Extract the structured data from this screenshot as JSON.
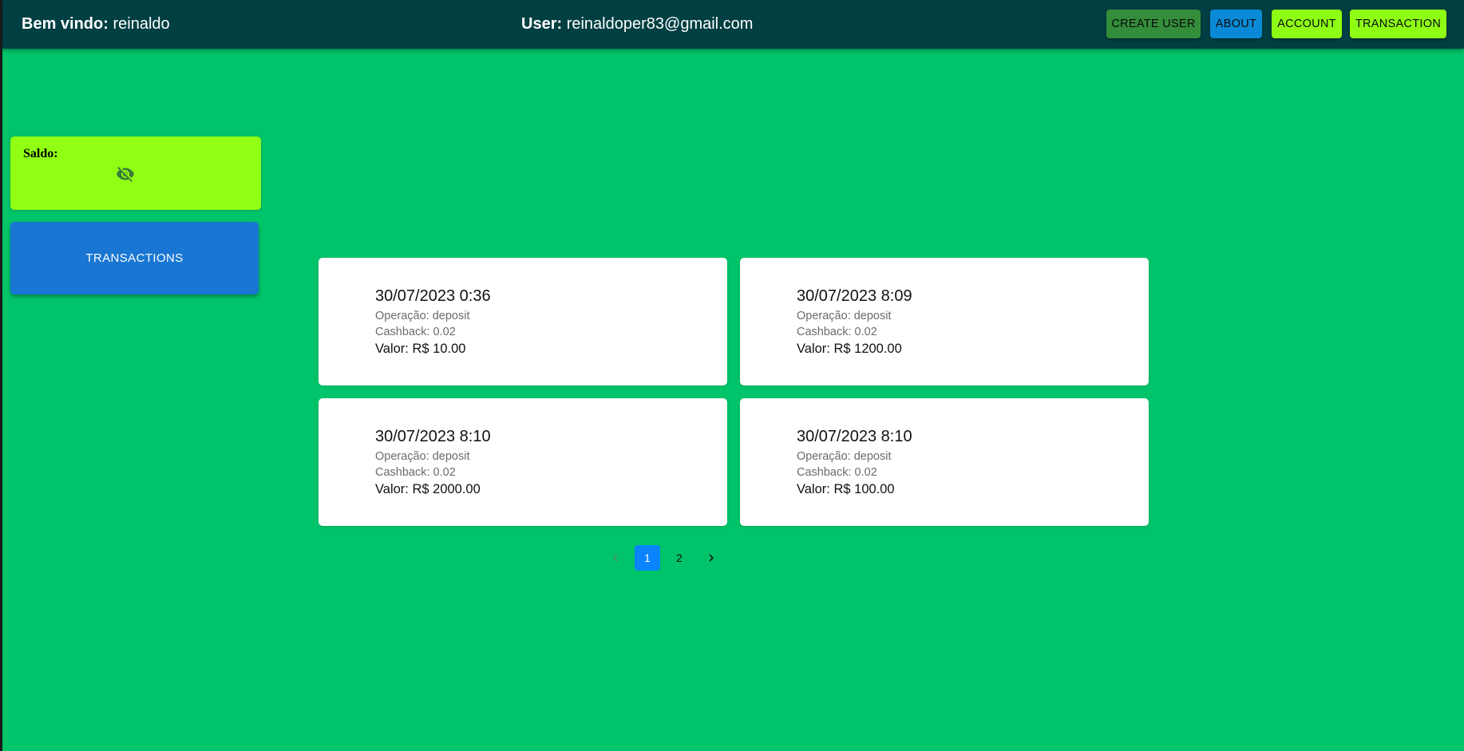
{
  "header": {
    "welcome_label": "Bem vindo:",
    "welcome_name": "reinaldo",
    "user_label": "User:",
    "user_email": "reinaldoper83@gmail.com",
    "buttons": {
      "create_user": "CREATE USER",
      "about": "ABOUT",
      "account": "ACCOUNT",
      "transaction": "TRANSACTION"
    }
  },
  "sidebar": {
    "saldo_label": "Saldo:",
    "saldo_icon": "eye-off-icon",
    "transactions_button": "TRANSACTIONS"
  },
  "transactions": [
    {
      "date": "30/07/2023 0:36",
      "operation": "Operação: deposit",
      "cashback": "Cashback: 0.02",
      "value": "Valor: R$ 10.00"
    },
    {
      "date": "30/07/2023 8:09",
      "operation": "Operação: deposit",
      "cashback": "Cashback: 0.02",
      "value": "Valor: R$ 1200.00"
    },
    {
      "date": "30/07/2023 8:10",
      "operation": "Operação: deposit",
      "cashback": "Cashback: 0.02",
      "value": "Valor: R$ 2000.00"
    },
    {
      "date": "30/07/2023 8:10",
      "operation": "Operação: deposit",
      "cashback": "Cashback: 0.02",
      "value": "Valor: R$ 100.00"
    }
  ],
  "pagination": {
    "pages": [
      "1",
      "2"
    ],
    "current": "1",
    "prev_icon": "chevron-left-icon",
    "next_icon": "chevron-right-icon"
  },
  "colors": {
    "background": "#00c46a",
    "appbar": "#003f42",
    "create_user": "#338d3b",
    "about": "#0a8ad6",
    "account": "#8eff14",
    "transaction": "#8eff14",
    "saldo_card": "#90ff14",
    "transactions_button": "#1976d2",
    "active_page": "#0a84ff"
  }
}
